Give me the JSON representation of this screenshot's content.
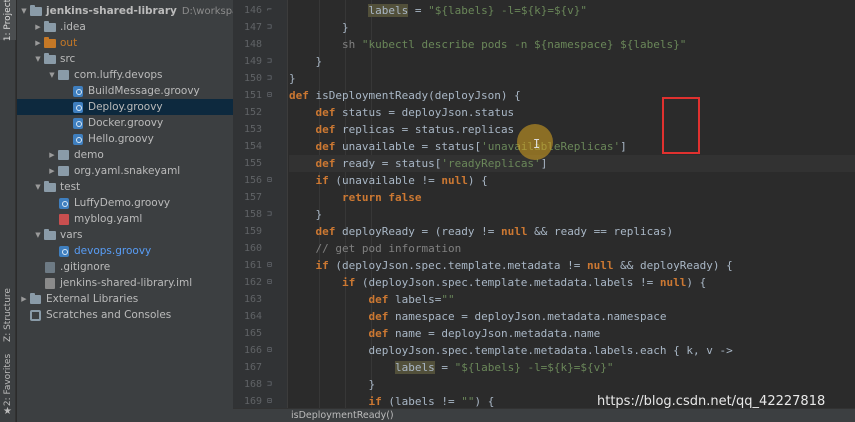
{
  "tool_tabs": {
    "project": "1: Project",
    "structure": "Z: Structure",
    "favorites": "2: Favorites"
  },
  "project_tree": {
    "root_name": "jenkins-shared-library",
    "root_path": "D:\\workspace\\luff",
    "items": [
      {
        "label": "jenkins-shared-library",
        "icon": "folder-icon",
        "depth": 0,
        "arrow": "▼"
      },
      {
        "label": ".idea",
        "icon": "folder-icon",
        "depth": 1,
        "arrow": "▶"
      },
      {
        "label": "out",
        "icon": "folder-orange-icon",
        "depth": 1,
        "arrow": "▶"
      },
      {
        "label": "src",
        "icon": "folder-icon",
        "depth": 1,
        "arrow": "▼"
      },
      {
        "label": "com.luffy.devops",
        "icon": "package-icon",
        "depth": 2,
        "arrow": "▼"
      },
      {
        "label": "BuildMessage.groovy",
        "icon": "groovy-file-icon",
        "depth": 3
      },
      {
        "label": "Deploy.groovy",
        "icon": "groovy-file-icon",
        "depth": 3,
        "selected": true
      },
      {
        "label": "Docker.groovy",
        "icon": "groovy-file-icon",
        "depth": 3
      },
      {
        "label": "Hello.groovy",
        "icon": "groovy-file-icon",
        "depth": 3
      },
      {
        "label": "demo",
        "icon": "package-icon",
        "depth": 2,
        "arrow": "▶"
      },
      {
        "label": "org.yaml.snakeyaml",
        "icon": "package-icon",
        "depth": 2,
        "arrow": "▶"
      },
      {
        "label": "test",
        "icon": "folder-icon",
        "depth": 1,
        "arrow": "▼"
      },
      {
        "label": "LuffyDemo.groovy",
        "icon": "groovy-file-icon",
        "depth": 2
      },
      {
        "label": "myblog.yaml",
        "icon": "yaml-file-icon",
        "depth": 2
      },
      {
        "label": "vars",
        "icon": "folder-icon",
        "depth": 1,
        "arrow": "▼"
      },
      {
        "label": "devops.groovy",
        "icon": "groovy-file-icon",
        "depth": 2,
        "blue": true
      },
      {
        "label": ".gitignore",
        "icon": "gitignore-file-icon",
        "depth": 1
      },
      {
        "label": "jenkins-shared-library.iml",
        "icon": "iml-file-icon",
        "depth": 1
      },
      {
        "label": "External Libraries",
        "icon": "library-icon",
        "depth": 0,
        "arrow": "▶"
      },
      {
        "label": "Scratches and Consoles",
        "icon": "scratch-icon",
        "depth": 0
      }
    ]
  },
  "editor": {
    "line_numbers": [
      "146",
      "147",
      "148",
      "149",
      "150",
      "151",
      "152",
      "153",
      "154",
      "155",
      "156",
      "157",
      "158",
      "159",
      "160",
      "161",
      "162",
      "163",
      "164",
      "165",
      "166",
      "167",
      "168",
      "169"
    ],
    "lines": [
      [
        {
          "t": "            "
        },
        {
          "t": "labels",
          "c": "tk-hl"
        },
        {
          "t": " = "
        },
        {
          "t": "\"${labels} -l=${k}=${v}\"",
          "c": "tk-str"
        }
      ],
      [
        {
          "t": "        }"
        }
      ],
      [
        {
          "t": "        "
        },
        {
          "t": "sh",
          "c": "tk-cm"
        },
        {
          "t": " "
        },
        {
          "t": "\"kubectl describe pods -n ${namespace} ${labels}\"",
          "c": "tk-str"
        }
      ],
      [
        {
          "t": "    }"
        }
      ],
      [
        {
          "t": "}"
        }
      ],
      [
        {
          "t": "def",
          "c": "tk-kw"
        },
        {
          "t": " isDeploymentReady(deployJson) {"
        }
      ],
      [
        {
          "t": "    "
        },
        {
          "t": "def",
          "c": "tk-kw"
        },
        {
          "t": " status = deployJson.status"
        }
      ],
      [
        {
          "t": "    "
        },
        {
          "t": "def",
          "c": "tk-kw"
        },
        {
          "t": " replicas = status.replicas"
        }
      ],
      [
        {
          "t": "    "
        },
        {
          "t": "def",
          "c": "tk-kw"
        },
        {
          "t": " unavailable = status["
        },
        {
          "t": "'unavailableReplicas'",
          "c": "tk-str"
        },
        {
          "t": "]"
        }
      ],
      [
        {
          "t": "    "
        },
        {
          "t": "def",
          "c": "tk-kw"
        },
        {
          "t": " ready = status["
        },
        {
          "t": "'readyReplicas'",
          "c": "tk-str"
        },
        {
          "t": "]"
        }
      ],
      [
        {
          "t": "    "
        },
        {
          "t": "if",
          "c": "tk-kw"
        },
        {
          "t": " (unavailable != "
        },
        {
          "t": "null",
          "c": "tk-kw"
        },
        {
          "t": ") {"
        }
      ],
      [
        {
          "t": "        "
        },
        {
          "t": "return false",
          "c": "tk-kw"
        }
      ],
      [
        {
          "t": "    }"
        }
      ],
      [
        {
          "t": "    "
        },
        {
          "t": "def",
          "c": "tk-kw"
        },
        {
          "t": " deployReady = (ready != "
        },
        {
          "t": "null",
          "c": "tk-kw"
        },
        {
          "t": " && ready == replicas)"
        }
      ],
      [
        {
          "t": "    "
        },
        {
          "t": "// get pod information",
          "c": "tk-cm"
        }
      ],
      [
        {
          "t": "    "
        },
        {
          "t": "if",
          "c": "tk-kw"
        },
        {
          "t": " (deployJson.spec.template.metadata != "
        },
        {
          "t": "null",
          "c": "tk-kw"
        },
        {
          "t": " && deployReady) {"
        }
      ],
      [
        {
          "t": "        "
        },
        {
          "t": "if",
          "c": "tk-kw"
        },
        {
          "t": " (deployJson.spec.template.metadata.labels != "
        },
        {
          "t": "null",
          "c": "tk-kw"
        },
        {
          "t": ") {"
        }
      ],
      [
        {
          "t": "            "
        },
        {
          "t": "def",
          "c": "tk-kw"
        },
        {
          "t": " labels="
        },
        {
          "t": "\"\"",
          "c": "tk-str"
        }
      ],
      [
        {
          "t": "            "
        },
        {
          "t": "def",
          "c": "tk-kw"
        },
        {
          "t": " namespace = deployJson.metadata.namespace"
        }
      ],
      [
        {
          "t": "            "
        },
        {
          "t": "def",
          "c": "tk-kw"
        },
        {
          "t": " name = deployJson.metadata.name"
        }
      ],
      [
        {
          "t": "            deployJson.spec.template.metadata.labels.each { k, v ->"
        }
      ],
      [
        {
          "t": "                "
        },
        {
          "t": "labels",
          "c": "tk-hl"
        },
        {
          "t": " = "
        },
        {
          "t": "\"${labels} -l=${k}=${v}\"",
          "c": "tk-str"
        }
      ],
      [
        {
          "t": "            }"
        }
      ],
      [
        {
          "t": "            "
        },
        {
          "t": "if",
          "c": "tk-kw"
        },
        {
          "t": " (labels != "
        },
        {
          "t": "\"\"",
          "c": "tk-str"
        },
        {
          "t": ") {"
        }
      ]
    ],
    "caret_line_index": 9
  },
  "breadcrumb": "isDeploymentReady()",
  "watermark": "https://blog.csdn.net/qq_42227818"
}
